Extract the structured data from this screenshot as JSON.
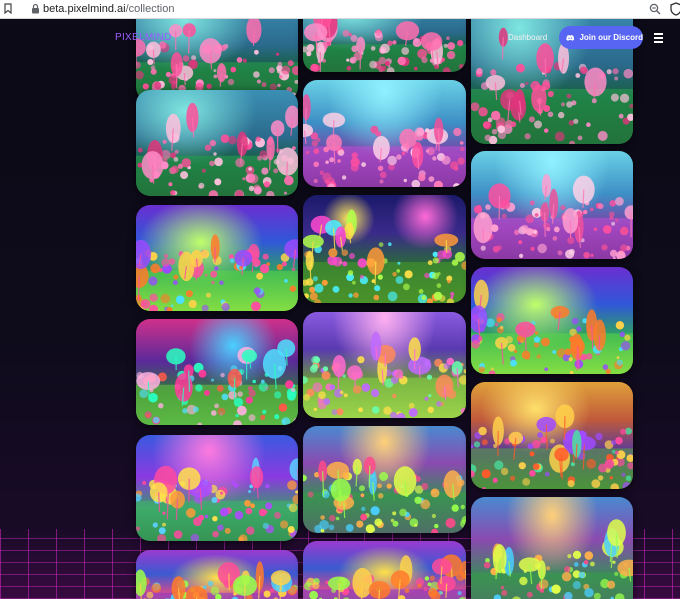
{
  "browser": {
    "url_domain": "beta.pixelmind.ai",
    "url_path": "/collection"
  },
  "nav": {
    "logo": "PIXELMIND",
    "dashboard_label": "Dashboard",
    "discord_label": "Join our Discord"
  },
  "colors": {
    "accent": "#9b5cff",
    "discord": "#5865f2",
    "background": "#0b0a14"
  },
  "gallery": {
    "columns": [
      {
        "cards": [
          {
            "theme": "flamingos"
          },
          {
            "theme": "flamingos"
          },
          {
            "theme": "neon-garden"
          },
          {
            "theme": "moon-forest"
          },
          {
            "theme": "purple-field"
          },
          {
            "theme": "psychedelic"
          }
        ]
      },
      {
        "cards": [
          {
            "theme": "flamingos"
          },
          {
            "theme": "flamingo-lake"
          },
          {
            "theme": "night-glow"
          },
          {
            "theme": "mushroom-field"
          },
          {
            "theme": "creature-crowd"
          },
          {
            "theme": "psychedelic"
          }
        ]
      },
      {
        "cards": [
          {
            "theme": "flamingos"
          },
          {
            "theme": "flamingo-lake"
          },
          {
            "theme": "neon-garden"
          },
          {
            "theme": "sunset-garden"
          },
          {
            "theme": "creature-crowd"
          }
        ]
      }
    ]
  }
}
